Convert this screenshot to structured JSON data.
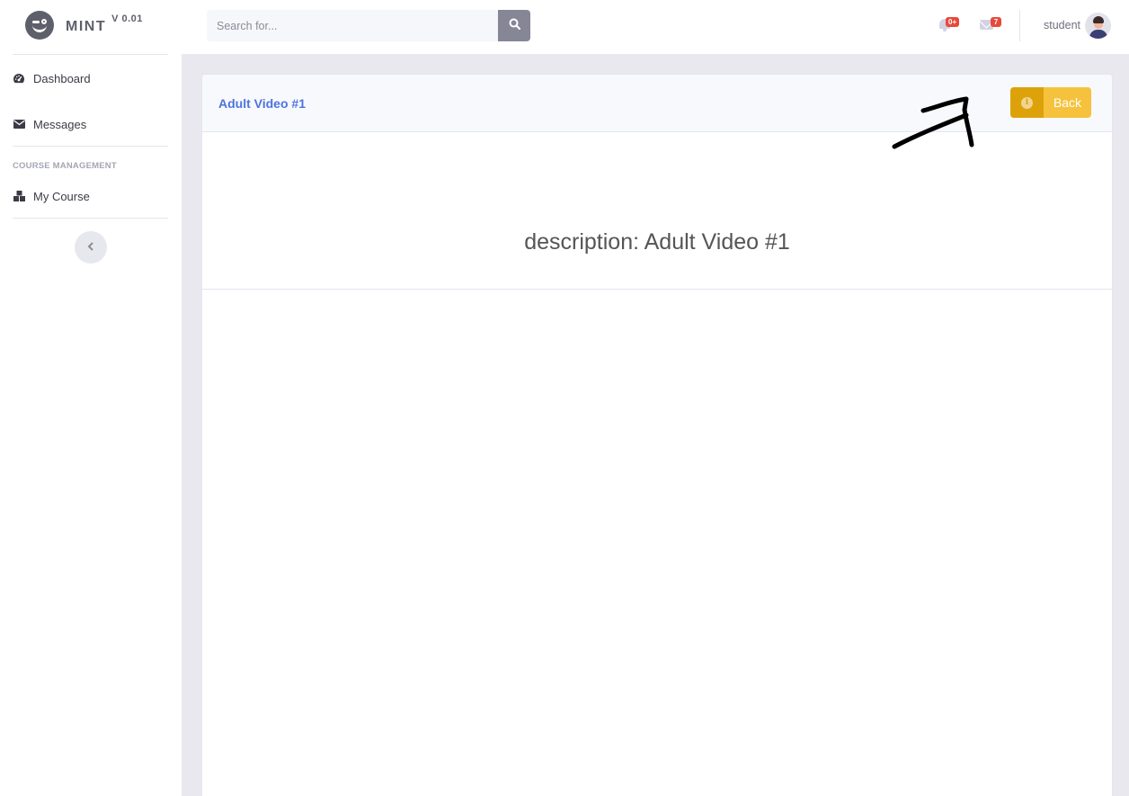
{
  "brand": {
    "name": "MINT",
    "version": "V 0.01"
  },
  "sidebar": {
    "items": [
      {
        "label": "Dashboard",
        "icon": "tachometer-icon"
      },
      {
        "label": "Messages",
        "icon": "envelope-icon"
      }
    ],
    "section_heading": "COURSE MANAGEMENT",
    "course_items": [
      {
        "label": "My Course",
        "icon": "cubes-icon"
      }
    ],
    "collapse_icon": "chevron-left-icon"
  },
  "topbar": {
    "search": {
      "placeholder": "Search for...",
      "value": ""
    },
    "alerts_badge": "0+",
    "messages_badge": "7",
    "user_name": "student"
  },
  "card": {
    "title": "Adult Video #1",
    "back_label": "Back",
    "description": "description: Adult Video #1"
  },
  "colors": {
    "primary": "#4e73df",
    "warning": "#f6c23e",
    "warning_dark": "#dda20a",
    "danger": "#e74a3b"
  }
}
